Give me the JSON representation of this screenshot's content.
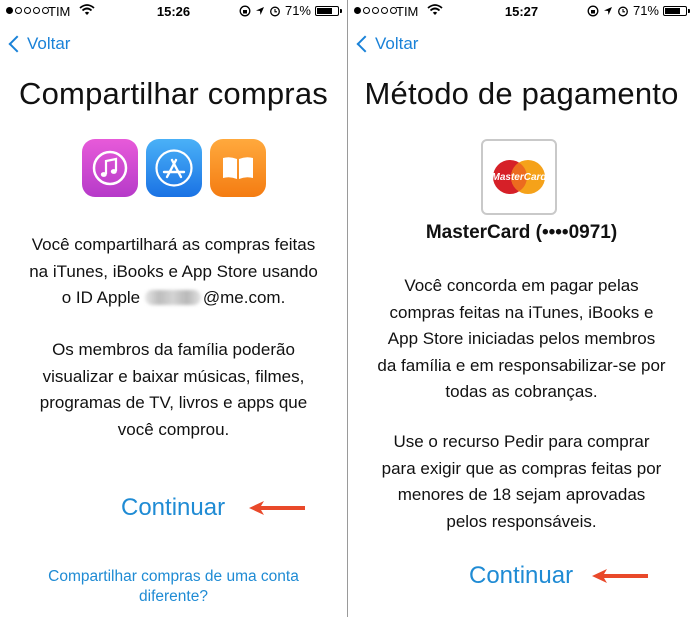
{
  "status_bar": {
    "carrier": "TIM",
    "battery": "71%",
    "left_time": "15:26",
    "right_time": "15:27"
  },
  "left_screen": {
    "back_label": "Voltar",
    "title": "Compartilhar compras",
    "icons": [
      "itunes-icon",
      "app-store-icon",
      "ibooks-icon"
    ],
    "description_lines": [
      "Você compartilhará as compras feitas",
      "na iTunes, iBooks e App Store usando",
      "o ID Apple",
      "@me.com."
    ],
    "members_lines": [
      "Os membros da família poderão",
      "visualizar e baixar músicas, filmes,",
      "programas de TV, livros e apps que",
      "você comprou."
    ],
    "continue_label": "Continuar",
    "other_account_lines": [
      "Compartilhar compras de uma conta",
      "diferente?"
    ]
  },
  "right_screen": {
    "back_label": "Voltar",
    "title": "Método de pagamento",
    "card_logo_text": "MasterCard",
    "card_name": "MasterCard (••••0971)",
    "agree_lines": [
      "Você concorda em pagar pelas",
      "compras feitas na iTunes, iBooks e",
      "App Store iniciadas pelos membros",
      "da família e em responsabilizar-se por",
      "todas as cobranças."
    ],
    "ask_lines": [
      "Use o recurso Pedir para comprar",
      "para exigir que as compras feitas por",
      "menores de 18 sejam aprovadas",
      "pelos responsáveis."
    ],
    "continue_label": "Continuar"
  },
  "colors": {
    "link_blue": "#1f8bd4",
    "arrow_red": "#e9492a",
    "itunes": "#d24ad3",
    "app_store": "#2a8cee",
    "ibooks": "#f8901f",
    "mastercard_red": "#d62028",
    "mastercard_orange": "#f5a21a"
  }
}
